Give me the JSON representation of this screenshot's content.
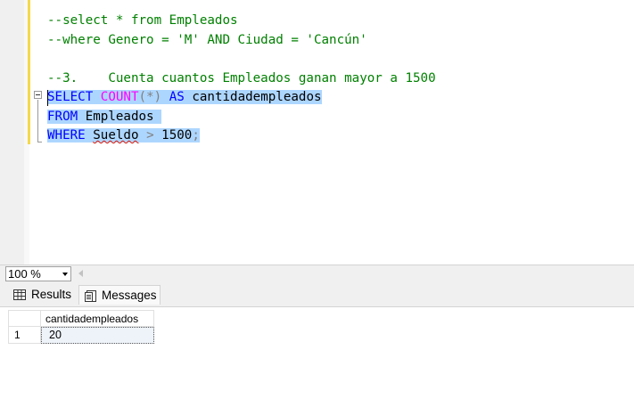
{
  "editor": {
    "lines": [
      {
        "segments": [
          {
            "text": "--select * from Empleados",
            "cls": "cmt"
          }
        ]
      },
      {
        "segments": [
          {
            "text": "--where Genero = 'M' AND Ciudad = 'Cancún'",
            "cls": "cmt"
          }
        ]
      },
      {
        "segments": [
          {
            "text": "",
            "cls": ""
          }
        ]
      },
      {
        "segments": [
          {
            "text": "--3.    Cuenta cuantos Empleados ganan mayor a 1500",
            "cls": "cmt"
          }
        ]
      },
      {
        "selected": true,
        "segments": [
          {
            "text": "SELECT",
            "cls": "kw"
          },
          {
            "text": " ",
            "cls": ""
          },
          {
            "text": "COUNT",
            "cls": "fn"
          },
          {
            "text": "(*)",
            "cls": "op"
          },
          {
            "text": " ",
            "cls": ""
          },
          {
            "text": "AS",
            "cls": "kw"
          },
          {
            "text": " cantidadempleados",
            "cls": ""
          }
        ]
      },
      {
        "selected": true,
        "segments": [
          {
            "text": "FROM",
            "cls": "kw"
          },
          {
            "text": " Empleados ",
            "cls": ""
          }
        ]
      },
      {
        "selected": true,
        "segments": [
          {
            "text": "WHERE",
            "cls": "kw"
          },
          {
            "text": " ",
            "cls": ""
          },
          {
            "text": "Sueldo",
            "cls": "err"
          },
          {
            "text": " ",
            "cls": ""
          },
          {
            "text": ">",
            "cls": "op"
          },
          {
            "text": " 1500",
            "cls": ""
          },
          {
            "text": ";",
            "cls": "op"
          }
        ]
      }
    ]
  },
  "statusbar": {
    "zoom": "100 %"
  },
  "tabs": {
    "results": "Results",
    "messages": "Messages"
  },
  "grid": {
    "columns": [
      "cantidadempleados"
    ],
    "rows": [
      {
        "num": "1",
        "cells": [
          "20"
        ]
      }
    ]
  },
  "icons": {
    "results_tab": "grid-table-icon",
    "messages_tab": "message-page-icon",
    "zoom_dropdown": "chevron-down-icon",
    "scroll": "scroll-left-arrow-icon",
    "outline": "collapse-minus-icon"
  }
}
